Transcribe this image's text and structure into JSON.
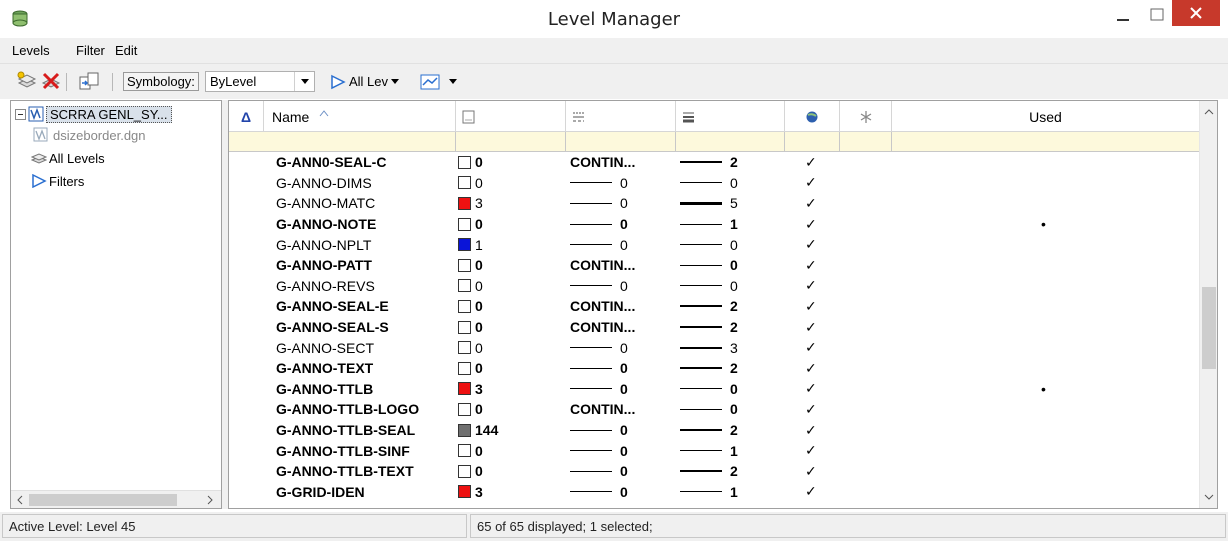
{
  "window": {
    "title": "Level Manager"
  },
  "menu": {
    "levels": "Levels",
    "filter": "Filter",
    "edit": "Edit"
  },
  "toolbar": {
    "symbology_label": "Symbology:",
    "symbology_value": "ByLevel",
    "all_levels": "All Lev"
  },
  "tree": {
    "root": "SCRRA GENL_SY...",
    "child": "dsizeborder.dgn",
    "all_levels": "All Levels",
    "filters": "Filters"
  },
  "columns": {
    "sort_marker": "Δ",
    "name": "Name",
    "used": "Used"
  },
  "rows": [
    {
      "name": "G-ANN0-SEAL-C",
      "bold": true,
      "color": "0",
      "swatch": "#ffffff",
      "style": "CONTIN...",
      "style_line": false,
      "weight": "2",
      "wpx": 2,
      "display": "✓",
      "used": ""
    },
    {
      "name": "G-ANNO-DIMS",
      "bold": false,
      "color": "0",
      "swatch": "#ffffff",
      "style": "0",
      "style_line": true,
      "weight": "0",
      "wpx": 1,
      "display": "✓",
      "used": ""
    },
    {
      "name": "G-ANNO-MATC",
      "bold": false,
      "color": "3",
      "swatch": "#ee1111",
      "style": "0",
      "style_line": true,
      "weight": "5",
      "wpx": 3,
      "display": "✓",
      "used": ""
    },
    {
      "name": "G-ANNO-NOTE",
      "bold": true,
      "color": "0",
      "swatch": "#ffffff",
      "style": "0",
      "style_line": true,
      "weight": "1",
      "wpx": 1,
      "display": "✓",
      "used": "•"
    },
    {
      "name": "G-ANNO-NPLT",
      "bold": false,
      "color": "1",
      "swatch": "#0a14d8",
      "style": "0",
      "style_line": true,
      "weight": "0",
      "wpx": 1,
      "display": "✓",
      "used": ""
    },
    {
      "name": "G-ANNO-PATT",
      "bold": true,
      "color": "0",
      "swatch": "#ffffff",
      "style": "CONTIN...",
      "style_line": false,
      "weight": "0",
      "wpx": 1,
      "display": "✓",
      "used": ""
    },
    {
      "name": "G-ANNO-REVS",
      "bold": false,
      "color": "0",
      "swatch": "#ffffff",
      "style": "0",
      "style_line": true,
      "weight": "0",
      "wpx": 1,
      "display": "✓",
      "used": ""
    },
    {
      "name": "G-ANNO-SEAL-E",
      "bold": true,
      "color": "0",
      "swatch": "#ffffff",
      "style": "CONTIN...",
      "style_line": false,
      "weight": "2",
      "wpx": 2,
      "display": "✓",
      "used": ""
    },
    {
      "name": "G-ANNO-SEAL-S",
      "bold": true,
      "color": "0",
      "swatch": "#ffffff",
      "style": "CONTIN...",
      "style_line": false,
      "weight": "2",
      "wpx": 2,
      "display": "✓",
      "used": ""
    },
    {
      "name": "G-ANNO-SECT",
      "bold": false,
      "color": "0",
      "swatch": "#ffffff",
      "style": "0",
      "style_line": true,
      "weight": "3",
      "wpx": 2,
      "display": "✓",
      "used": ""
    },
    {
      "name": "G-ANNO-TEXT",
      "bold": true,
      "color": "0",
      "swatch": "#ffffff",
      "style": "0",
      "style_line": true,
      "weight": "2",
      "wpx": 2,
      "display": "✓",
      "used": ""
    },
    {
      "name": "G-ANNO-TTLB",
      "bold": true,
      "color": "3",
      "swatch": "#ee1111",
      "style": "0",
      "style_line": true,
      "weight": "0",
      "wpx": 1,
      "display": "✓",
      "used": "•"
    },
    {
      "name": "G-ANNO-TTLB-LOGO",
      "bold": true,
      "color": "0",
      "swatch": "#ffffff",
      "style": "CONTIN...",
      "style_line": false,
      "weight": "0",
      "wpx": 1,
      "display": "✓",
      "used": ""
    },
    {
      "name": "G-ANNO-TTLB-SEAL",
      "bold": true,
      "color": "144",
      "swatch": "#707070",
      "style": "0",
      "style_line": true,
      "weight": "2",
      "wpx": 2,
      "display": "✓",
      "used": ""
    },
    {
      "name": "G-ANNO-TTLB-SINF",
      "bold": true,
      "color": "0",
      "swatch": "#ffffff",
      "style": "0",
      "style_line": true,
      "weight": "1",
      "wpx": 1,
      "display": "✓",
      "used": ""
    },
    {
      "name": "G-ANNO-TTLB-TEXT",
      "bold": true,
      "color": "0",
      "swatch": "#ffffff",
      "style": "0",
      "style_line": true,
      "weight": "2",
      "wpx": 2,
      "display": "✓",
      "used": ""
    },
    {
      "name": "G-GRID-IDEN",
      "bold": true,
      "color": "3",
      "swatch": "#ee1111",
      "style": "0",
      "style_line": true,
      "weight": "1",
      "wpx": 1,
      "display": "✓",
      "used": ""
    }
  ],
  "status": {
    "active_level": "Active Level: Level 45",
    "displayed": "65 of 65 displayed; 1 selected;"
  }
}
